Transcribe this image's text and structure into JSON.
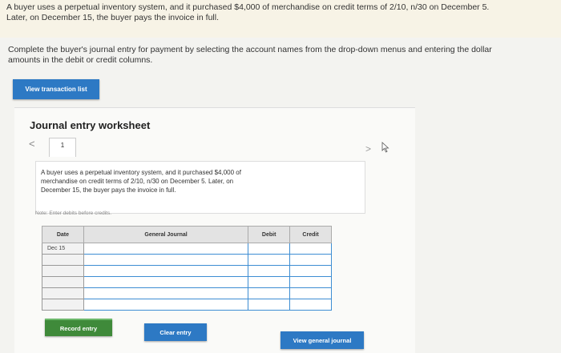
{
  "question": {
    "line1": "A buyer uses a perpetual inventory system, and it purchased $4,000 of merchandise on credit terms of 2/10, n/30 on December 5.",
    "line2": "Later, on December 15, the buyer pays the invoice in full.",
    "instruction1": "Complete the buyer's journal entry for payment by selecting the account names from the drop-down menus and entering the dollar",
    "instruction2": "amounts in the debit or credit columns."
  },
  "buttons": {
    "view_transaction_list": "View transaction list",
    "record_entry": "Record entry",
    "clear_entry": "Clear entry",
    "view_general_journal": "View general journal"
  },
  "worksheet": {
    "title": "Journal entry worksheet",
    "prev_nav": "<",
    "next_nav": ">",
    "tab_number": "1",
    "description_line1": "A buyer uses a perpetual inventory system, and it purchased $4,000 of",
    "description_line2": "merchandise on credit terms of 2/10, n/30 on December 5. Later, on",
    "description_line3": "December 15, the buyer pays the invoice in full.",
    "note": "Note: Enter debits before credits."
  },
  "table": {
    "headers": {
      "date": "Date",
      "general_journal": "General Journal",
      "debit": "Debit",
      "credit": "Credit"
    },
    "rows": [
      {
        "date": "Dec 15",
        "account": "",
        "debit": "",
        "credit": ""
      },
      {
        "date": "",
        "account": "",
        "debit": "",
        "credit": ""
      },
      {
        "date": "",
        "account": "",
        "debit": "",
        "credit": ""
      },
      {
        "date": "",
        "account": "",
        "debit": "",
        "credit": ""
      },
      {
        "date": "",
        "account": "",
        "debit": "",
        "credit": ""
      },
      {
        "date": "",
        "account": "",
        "debit": "",
        "credit": ""
      }
    ]
  },
  "colors": {
    "blue_button": "#2d79c4",
    "green_button": "#3f8a3a",
    "input_border": "#3d8dd3"
  }
}
